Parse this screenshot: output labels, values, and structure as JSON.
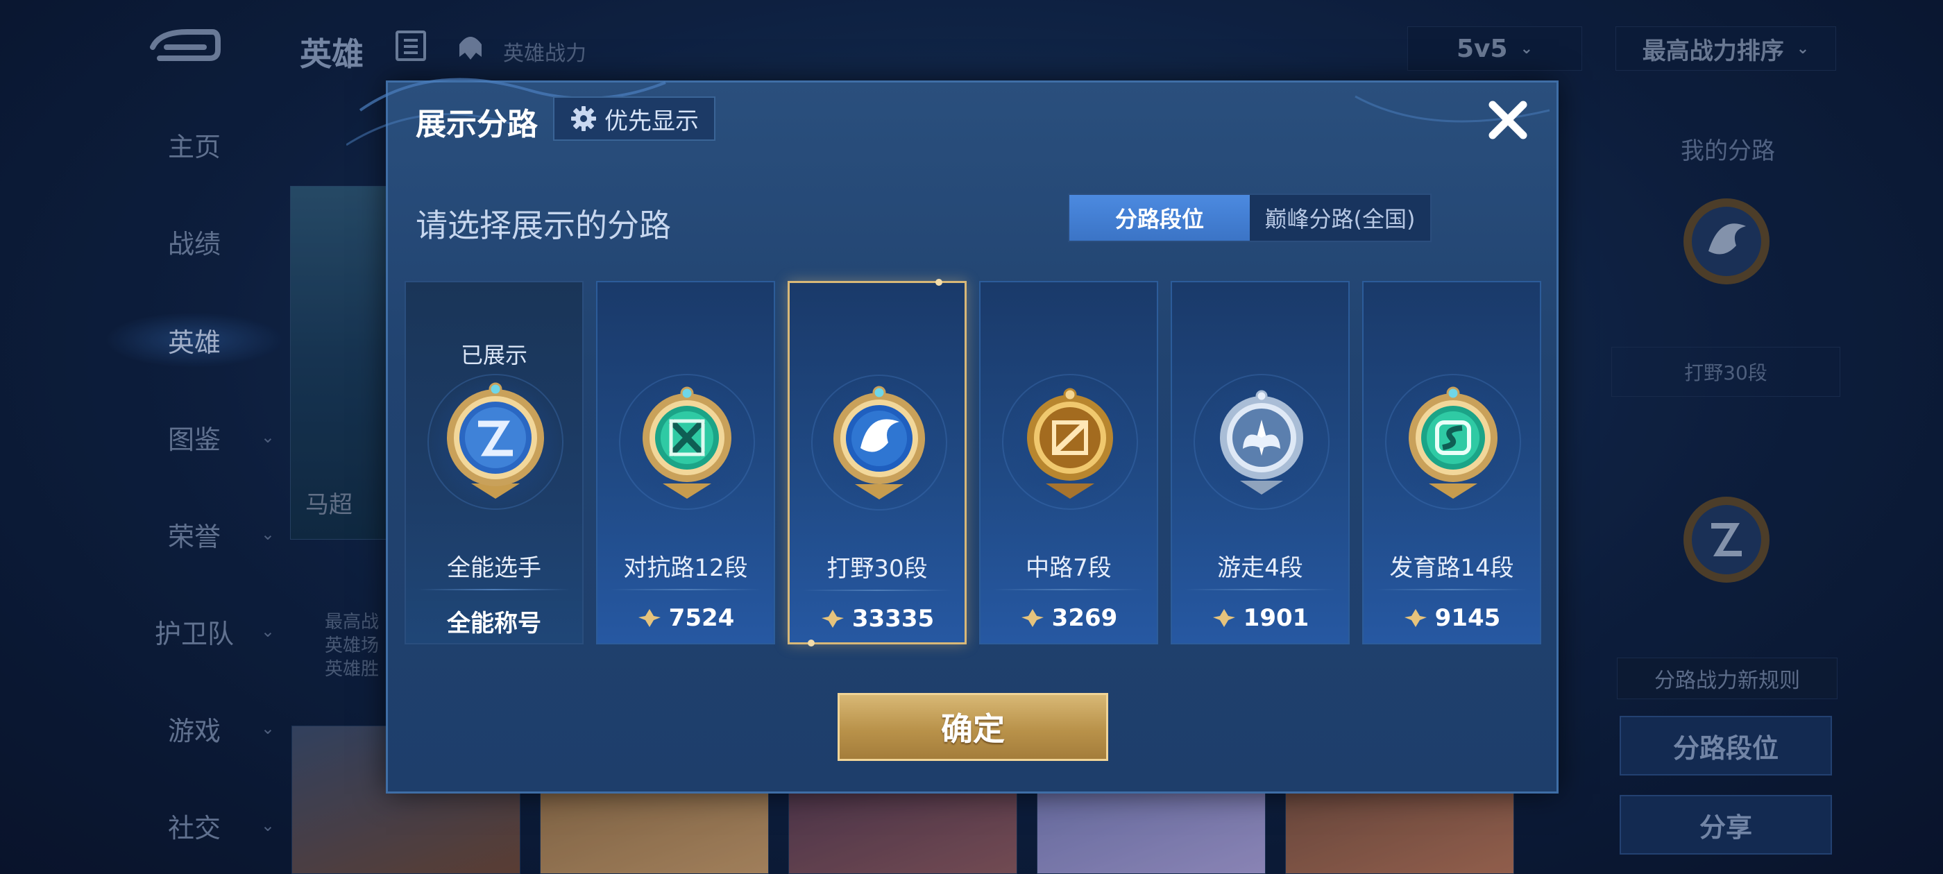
{
  "background": {
    "top_title": "英雄",
    "top_sub_label": "英雄战力",
    "mode_select": "5v5",
    "sort_select": "最高战力排序",
    "nav": [
      {
        "label": "主页",
        "chevron": false,
        "active": false
      },
      {
        "label": "战绩",
        "chevron": false,
        "active": false
      },
      {
        "label": "英雄",
        "chevron": false,
        "active": true
      },
      {
        "label": "图鉴",
        "chevron": true,
        "active": false
      },
      {
        "label": "荣誉",
        "chevron": true,
        "active": false
      },
      {
        "label": "护卫队",
        "chevron": true,
        "active": false
      },
      {
        "label": "游戏",
        "chevron": true,
        "active": false
      },
      {
        "label": "社交",
        "chevron": true,
        "active": false
      }
    ],
    "hero_name": "马超",
    "hero_stats": [
      "最高战",
      "英雄场",
      "英雄胜"
    ],
    "right_panel": {
      "title": "我的分路",
      "lane_tag": "打野30段",
      "rules_link": "分路战力新规则",
      "lane_rank_button": "分路段位",
      "share_button": "分享"
    }
  },
  "modal": {
    "title": "展示分路",
    "priority_button": "优先显示",
    "subtitle": "请选择展示的分路",
    "tabs": [
      {
        "label": "分路段位",
        "active": true
      },
      {
        "label": "巅峰分路(全国)",
        "active": false
      }
    ],
    "cards": [
      {
        "status": "已展示",
        "label": "全能选手",
        "value": "全能称号",
        "show_power_icon": false,
        "icon": "all-round-badge-icon",
        "selected": false
      },
      {
        "status": "",
        "label": "对抗路12段",
        "value": "7524",
        "show_power_icon": true,
        "icon": "clash-lane-badge-icon",
        "selected": false
      },
      {
        "status": "",
        "label": "打野30段",
        "value": "33335",
        "show_power_icon": true,
        "icon": "jungle-badge-icon",
        "selected": true
      },
      {
        "status": "",
        "label": "中路7段",
        "value": "3269",
        "show_power_icon": true,
        "icon": "mid-lane-badge-icon",
        "selected": false
      },
      {
        "status": "",
        "label": "游走4段",
        "value": "1901",
        "show_power_icon": true,
        "icon": "roam-badge-icon",
        "selected": false
      },
      {
        "status": "",
        "label": "发育路14段",
        "value": "9145",
        "show_power_icon": true,
        "icon": "farm-lane-badge-icon",
        "selected": false
      }
    ],
    "confirm_button": "确定"
  },
  "colors": {
    "modal_bg": "#214370",
    "accent_blue": "#3b74c6",
    "gold": "#d8b875",
    "selected_border": "#d8b878"
  }
}
